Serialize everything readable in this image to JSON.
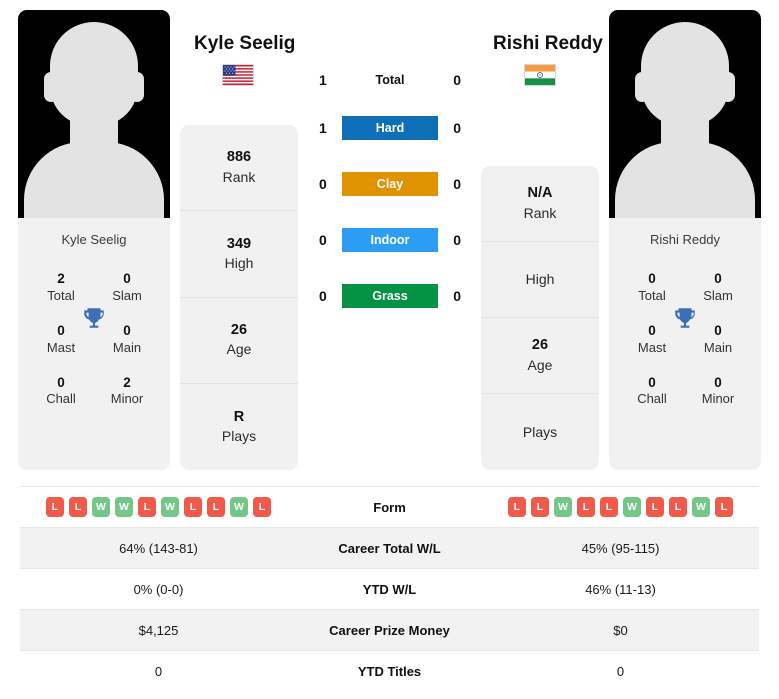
{
  "players": {
    "left": {
      "name": "Kyle Seelig",
      "photo_caption": "Kyle Seelig",
      "flag": "us-flag",
      "stats": [
        {
          "value": "886",
          "label": "Rank"
        },
        {
          "value": "349",
          "label": "High"
        },
        {
          "value": "26",
          "label": "Age"
        },
        {
          "value": "R",
          "label": "Plays"
        }
      ],
      "titles": [
        {
          "value": "2",
          "label": "Total"
        },
        {
          "value": "0",
          "label": "Slam"
        },
        {
          "value": "0",
          "label": "Mast"
        },
        {
          "value": "0",
          "label": "Main"
        },
        {
          "value": "0",
          "label": "Chall"
        },
        {
          "value": "2",
          "label": "Minor"
        }
      ],
      "form": [
        "L",
        "L",
        "W",
        "W",
        "L",
        "W",
        "L",
        "L",
        "W",
        "L"
      ]
    },
    "right": {
      "name": "Rishi Reddy",
      "photo_caption": "Rishi Reddy",
      "flag": "in-flag",
      "stats": [
        {
          "value": "N/A",
          "label": "Rank"
        },
        {
          "value": "",
          "label": "High"
        },
        {
          "value": "26",
          "label": "Age"
        },
        {
          "value": "",
          "label": "Plays"
        }
      ],
      "titles": [
        {
          "value": "0",
          "label": "Total"
        },
        {
          "value": "0",
          "label": "Slam"
        },
        {
          "value": "0",
          "label": "Mast"
        },
        {
          "value": "0",
          "label": "Main"
        },
        {
          "value": "0",
          "label": "Chall"
        },
        {
          "value": "0",
          "label": "Minor"
        }
      ],
      "form": [
        "L",
        "L",
        "W",
        "L",
        "L",
        "W",
        "L",
        "L",
        "W",
        "L"
      ]
    }
  },
  "h2h": [
    {
      "label": "Total",
      "left": "1",
      "right": "0",
      "badge": false,
      "color": ""
    },
    {
      "label": "Hard",
      "left": "1",
      "right": "0",
      "badge": true,
      "color": "#0e6eb8"
    },
    {
      "label": "Clay",
      "left": "0",
      "right": "0",
      "badge": true,
      "color": "#e09200"
    },
    {
      "label": "Indoor",
      "left": "0",
      "right": "0",
      "badge": true,
      "color": "#2b9ef3"
    },
    {
      "label": "Grass",
      "left": "0",
      "right": "0",
      "badge": true,
      "color": "#049344"
    }
  ],
  "comparison": [
    {
      "label": "Form",
      "left": "",
      "right": ""
    },
    {
      "label": "Career Total W/L",
      "left": "64% (143-81)",
      "right": "45% (95-115)"
    },
    {
      "label": "YTD W/L",
      "left": "0% (0-0)",
      "right": "46% (11-13)"
    },
    {
      "label": "Career Prize Money",
      "left": "$4,125",
      "right": "$0"
    },
    {
      "label": "YTD Titles",
      "left": "0",
      "right": "0"
    }
  ],
  "icons": {
    "trophy": "trophy-icon"
  },
  "colors": {
    "hard": "#0e6eb8",
    "clay": "#e09200",
    "indoor": "#2b9ef3",
    "grass": "#049344",
    "win": "#74c788",
    "loss": "#f05a4b",
    "trophy": "#3d6fb5"
  }
}
